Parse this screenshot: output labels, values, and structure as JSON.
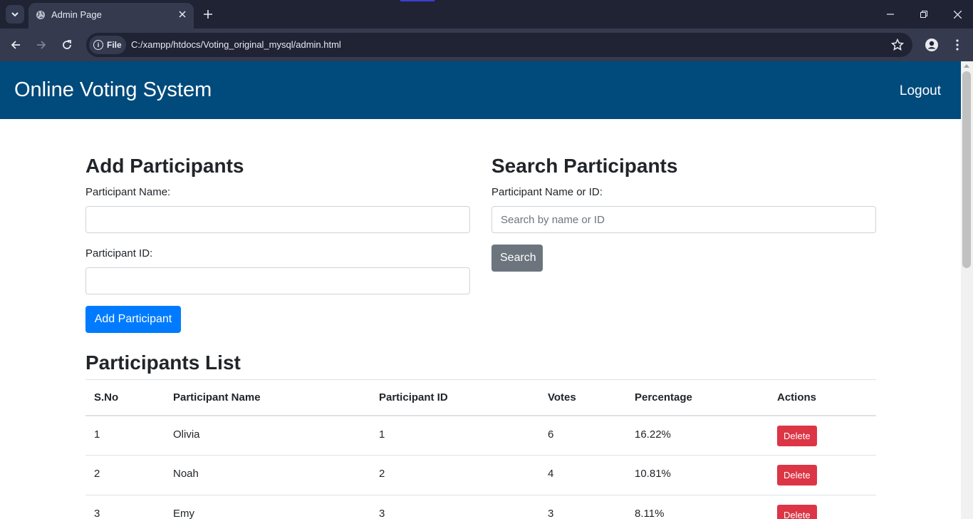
{
  "browser": {
    "tab_title": "Admin Page",
    "file_label": "File",
    "url": "C:/xampp/htdocs/Voting_original_mysql/admin.html"
  },
  "navbar": {
    "brand": "Online Voting System",
    "logout": "Logout"
  },
  "add_section": {
    "title": "Add Participants",
    "name_label": "Participant Name:",
    "name_value": "",
    "id_label": "Participant ID:",
    "id_value": "",
    "button": "Add Participant"
  },
  "search_section": {
    "title": "Search Participants",
    "label": "Participant Name or ID:",
    "placeholder": "Search by name or ID",
    "button": "Search"
  },
  "list": {
    "title": "Participants List",
    "headers": [
      "S.No",
      "Participant Name",
      "Participant ID",
      "Votes",
      "Percentage",
      "Actions"
    ],
    "rows": [
      {
        "sno": "1",
        "name": "Olivia",
        "id": "1",
        "votes": "6",
        "percentage": "16.22%",
        "action": "Delete"
      },
      {
        "sno": "2",
        "name": "Noah",
        "id": "2",
        "votes": "4",
        "percentage": "10.81%",
        "action": "Delete"
      },
      {
        "sno": "3",
        "name": "Emy",
        "id": "3",
        "votes": "3",
        "percentage": "8.11%",
        "action": "Delete"
      }
    ]
  },
  "colors": {
    "navbar": "#004a7c",
    "primary": "#007bff",
    "secondary": "#6c757d",
    "danger": "#dc3545"
  }
}
